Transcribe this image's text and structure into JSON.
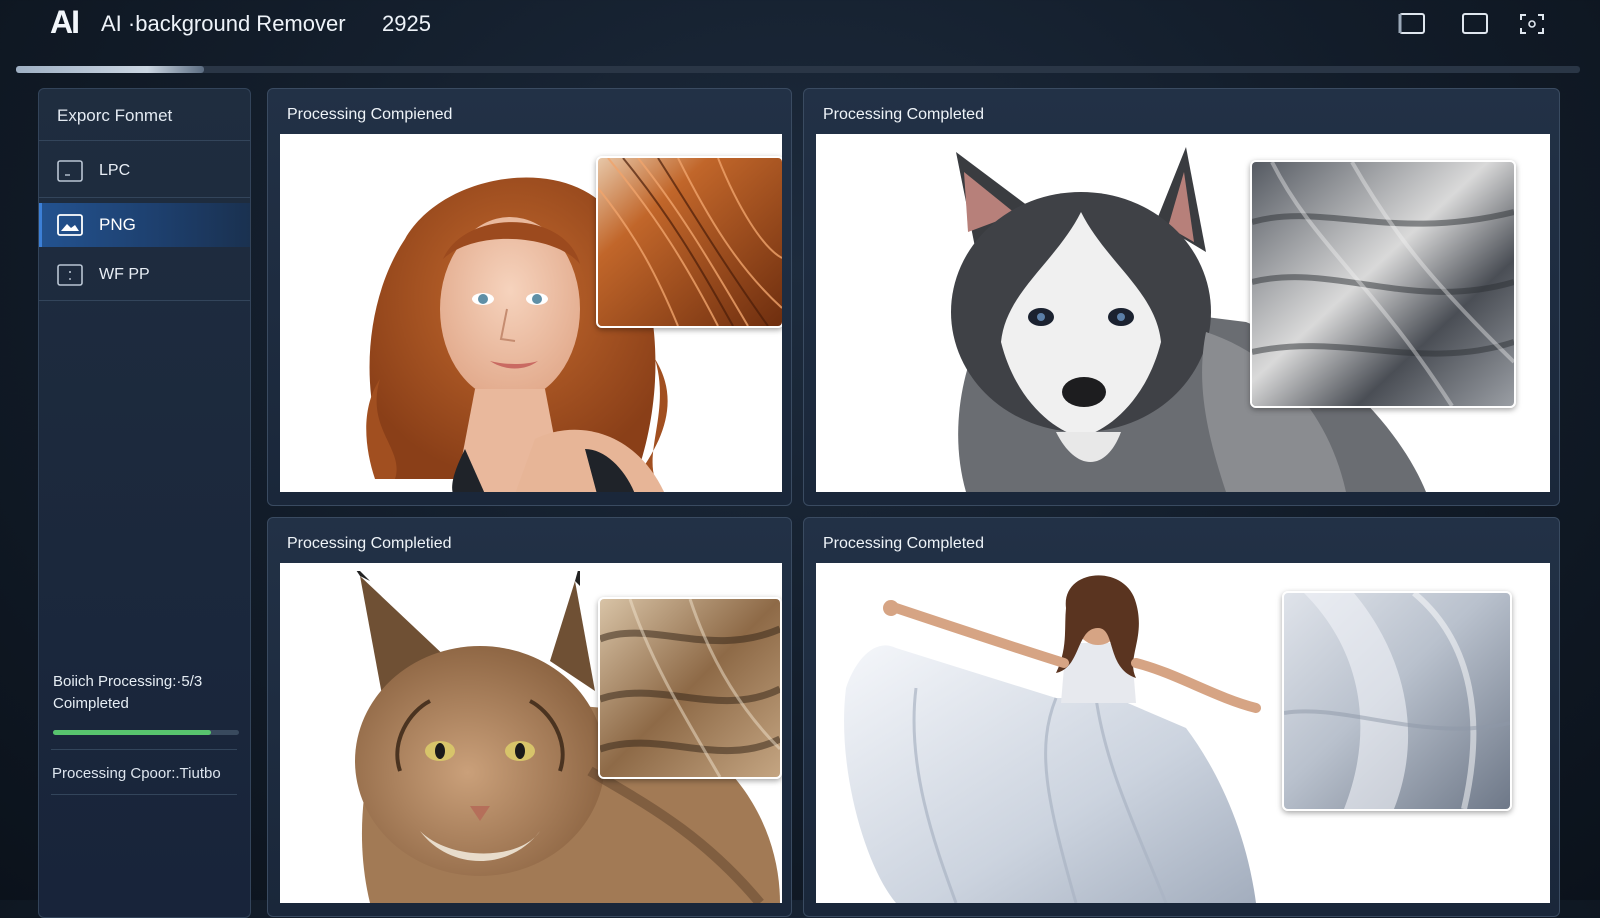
{
  "app": {
    "logo": "AI",
    "title": "AI ·background Remover",
    "year": "2925"
  },
  "window_controls": [
    {
      "name": "minimize",
      "icon": "window-minimize-icon"
    },
    {
      "name": "maximize",
      "icon": "window-maximize-icon"
    },
    {
      "name": "fullscreen",
      "icon": "fullscreen-icon"
    }
  ],
  "overall_progress": 0.12,
  "sidebar": {
    "title": "Exporc Fonmet",
    "formats": [
      {
        "label": "LPC",
        "icon": "image-file-icon",
        "selected": false
      },
      {
        "label": "PNG",
        "icon": "image-file-icon",
        "selected": true
      },
      {
        "label": "WF PP",
        "icon": "image-file-icon",
        "selected": false
      }
    ],
    "batch_label": "Boiich Processing:·5/3 Coimpleted",
    "batch_progress": 0.85,
    "speed_label": "Processing Cpoor:.Tiutbo"
  },
  "cards": [
    {
      "title": "Processing Compiened",
      "subject": "red-haired-woman",
      "detail": "hair-closeup"
    },
    {
      "title": "Processing Completed",
      "subject": "husky-puppy",
      "detail": "fur-closeup"
    },
    {
      "title": "Processing Completied",
      "subject": "lynx",
      "detail": "lynx-fur-closeup"
    },
    {
      "title": "Processing Completed",
      "subject": "woman-in-white-dress",
      "detail": "fabric-closeup"
    }
  ],
  "colors": {
    "accent_selected": "#23528f",
    "progress_green": "#58c46e",
    "card_background": "#1f2d40",
    "page_background": "#121c29"
  }
}
